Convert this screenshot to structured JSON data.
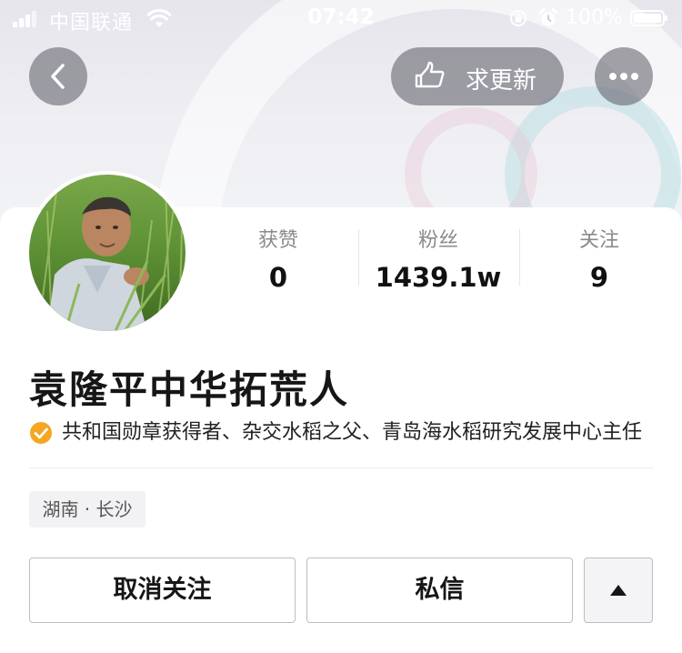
{
  "status_bar": {
    "carrier": "中国联通",
    "time": "07:42",
    "battery": "100%"
  },
  "header": {
    "back_icon": "chevron-left-icon",
    "update_label": "求更新",
    "update_icon": "pointing-hand-icon",
    "more_icon": "ellipsis-icon"
  },
  "profile": {
    "name": "袁隆平中华拓荒人",
    "verified_text": "共和国勋章获得者、杂交水稻之父、青岛海水稻研究发展中心主任",
    "location": "湖南 · 长沙"
  },
  "stats": [
    {
      "label": "获赞",
      "value": "0"
    },
    {
      "label": "粉丝",
      "value": "1439.1w"
    },
    {
      "label": "关注",
      "value": "9"
    }
  ],
  "actions": {
    "unfollow_label": "取消关注",
    "message_label": "私信",
    "collapse_icon": "triangle-up-icon"
  },
  "colors": {
    "verified_badge": "#f5a623",
    "overlay_button": "#5a5a62"
  }
}
